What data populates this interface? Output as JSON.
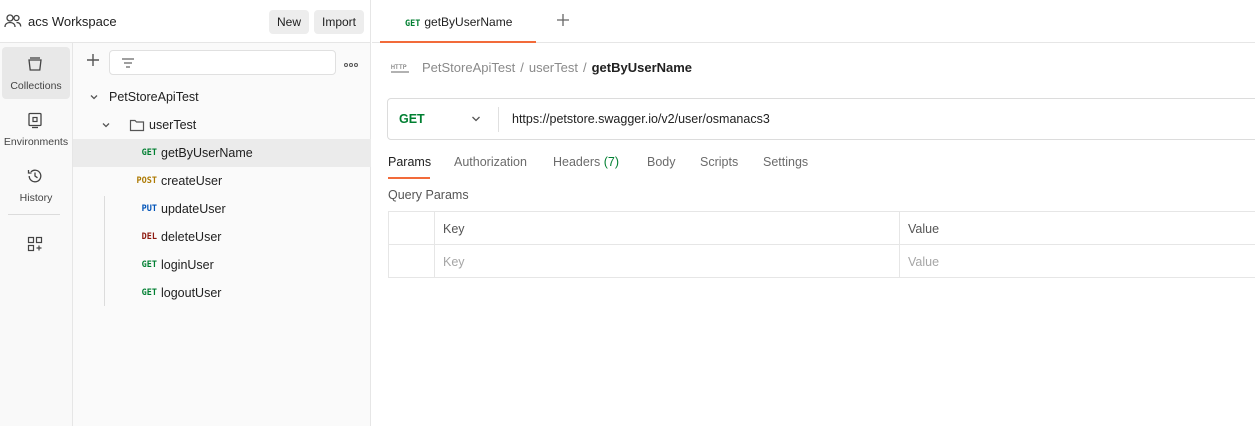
{
  "workspace": {
    "title": "acs Workspace",
    "new_label": "New",
    "import_label": "Import"
  },
  "rail": {
    "items": [
      {
        "label": "Collections",
        "icon": "collections-icon"
      },
      {
        "label": "Environments",
        "icon": "environments-icon"
      },
      {
        "label": "History",
        "icon": "history-icon"
      }
    ],
    "extra_icon": "apps-icon"
  },
  "sidebar": {
    "collection": "PetStoreApiTest",
    "folder": "userTest",
    "requests": [
      {
        "method": "GET",
        "name": "getByUserName",
        "selected": true
      },
      {
        "method": "POST",
        "name": "createUser"
      },
      {
        "method": "PUT",
        "name": "updateUser"
      },
      {
        "method": "DEL",
        "name": "deleteUser"
      },
      {
        "method": "GET",
        "name": "loginUser"
      },
      {
        "method": "GET",
        "name": "logoutUser"
      }
    ]
  },
  "tabs": {
    "active": {
      "method": "GET",
      "name": "getByUserName"
    },
    "add_symbol": "+"
  },
  "breadcrumb": {
    "collection": "PetStoreApiTest",
    "folder": "userTest",
    "current": "getByUserName",
    "sep": "/"
  },
  "request": {
    "method": "GET",
    "url": "https://petstore.swagger.io/v2/user/osmanacs3"
  },
  "request_tabs": {
    "params": "Params",
    "authorization": "Authorization",
    "headers": "Headers",
    "headers_count": "(7)",
    "body": "Body",
    "scripts": "Scripts",
    "settings": "Settings"
  },
  "query_params": {
    "title": "Query Params",
    "col_key": "Key",
    "col_value": "Value",
    "placeholder_key": "Key",
    "placeholder_value": "Value"
  },
  "colors": {
    "accent": "#f26b3a",
    "get": "#007f31",
    "post": "#ad7a03",
    "put": "#0053b8",
    "delete": "#8e1a10"
  }
}
